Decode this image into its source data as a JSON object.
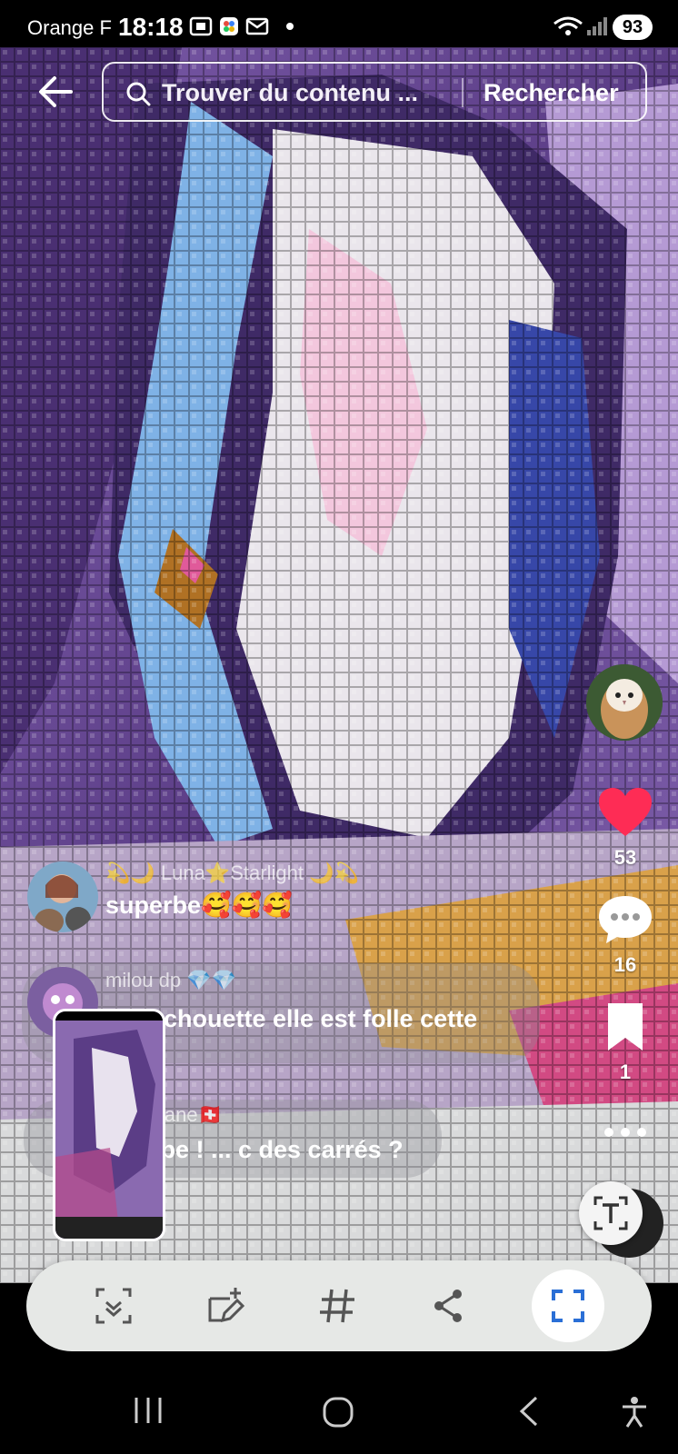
{
  "status_bar": {
    "carrier": "Orange F",
    "time": "18:18",
    "battery": "93",
    "icons": [
      "screenshot-icon",
      "app-icon",
      "mail-icon",
      "dot-icon",
      "wifi-icon",
      "signal-icon"
    ]
  },
  "search": {
    "placeholder": "Trouver du contenu ...",
    "submit_label": "Rechercher"
  },
  "rail": {
    "likes": "53",
    "comments": "16",
    "saves": "1"
  },
  "comments": [
    {
      "name": "💫🌙 Luna⭐Starlight 🌙💫",
      "text": "superbe🥰🥰🥰"
    },
    {
      "name": "milou dp 💎💎",
      "text": "chouette elle est folle cette"
    },
    {
      "name": "iane🇨🇭",
      "text": "rbe ! ... c des carrés ?"
    }
  ],
  "toolbar": {
    "tools": [
      "smart-select-icon",
      "draw-icon",
      "hashtag-icon",
      "share-icon",
      "crop-icon"
    ]
  },
  "colors": {
    "like": "#fe2c55",
    "toolbar_bg": "#e6e8e6",
    "active_tool": "#2a6fd6"
  }
}
